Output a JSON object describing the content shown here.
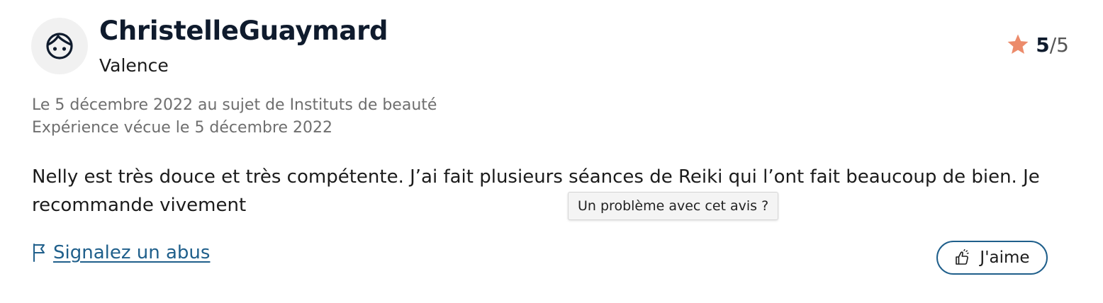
{
  "review": {
    "author": "ChristelleGuaymard",
    "city": "Valence",
    "rating": {
      "score": "5",
      "separator": "/",
      "max": "5",
      "star_color": "#ec8b6b"
    },
    "meta_line1": "Le 5 décembre 2022 au sujet de Instituts de beauté",
    "meta_line2": "Expérience vécue le 5 décembre 2022",
    "text": "Nelly est très douce et très compétente. J’ai fait plusieurs séances de Reiki qui l’ont fait beaucoup de bien. Je recommande vivement",
    "tooltip": "Un problème avec cet avis ?",
    "report_label": "Signalez un abus",
    "like_label": "J'aime"
  },
  "icons": {
    "avatar": "face-icon",
    "rating": "star-icon",
    "report": "flag-icon",
    "like": "thumbs-up-icon"
  },
  "colors": {
    "link": "#1f5f8b",
    "title": "#0f1b2d",
    "meta": "#6e6e6e",
    "star": "#ec8b6b"
  }
}
